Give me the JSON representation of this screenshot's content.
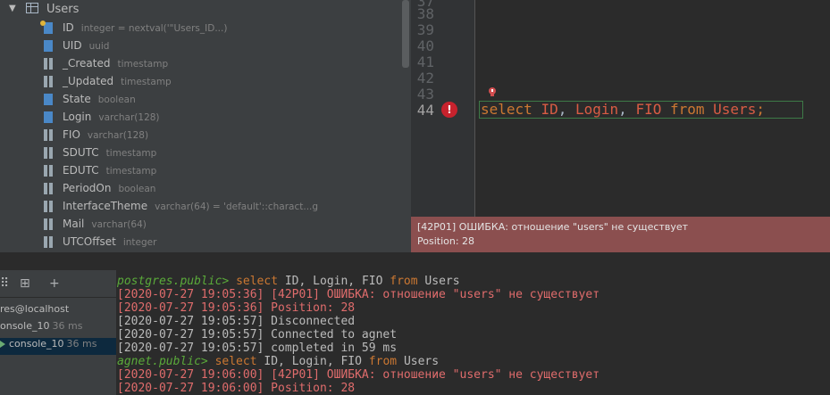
{
  "tree": {
    "table_name": "Users",
    "columns": [
      {
        "name": "ID",
        "type": "integer = nextval('\"Users_ID...)",
        "icon": "pk-column-icon"
      },
      {
        "name": "UID",
        "type": "uuid",
        "icon": "column-icon"
      },
      {
        "name": "_Created",
        "type": "timestamp",
        "icon": "column-icon"
      },
      {
        "name": "_Updated",
        "type": "timestamp",
        "icon": "column-icon"
      },
      {
        "name": "State",
        "type": "boolean",
        "icon": "column-icon"
      },
      {
        "name": "Login",
        "type": "varchar(128)",
        "icon": "column-icon"
      },
      {
        "name": "FIO",
        "type": "varchar(128)",
        "icon": "column-icon"
      },
      {
        "name": "SDUTC",
        "type": "timestamp",
        "icon": "column-icon"
      },
      {
        "name": "EDUTC",
        "type": "timestamp",
        "icon": "column-icon"
      },
      {
        "name": "PeriodOn",
        "type": "boolean",
        "icon": "column-icon"
      },
      {
        "name": "InterfaceTheme",
        "type": "varchar(64) = 'default'::charact...g",
        "icon": "column-icon"
      },
      {
        "name": "Mail",
        "type": "varchar(64)",
        "icon": "column-icon"
      },
      {
        "name": "UTCOffset",
        "type": "integer",
        "icon": "column-icon"
      }
    ]
  },
  "editor": {
    "line_numbers": [
      "37",
      "38",
      "39",
      "40",
      "41",
      "42",
      "43",
      "44"
    ],
    "code": {
      "k1": "select",
      "id1": "ID",
      "c1": ",",
      "id2": "Login",
      "c2": ",",
      "id3": "FIO",
      "k2": "from",
      "id4": "Users",
      "semi": ";"
    },
    "error_popup": {
      "line1": "[42P01] ОШИБКА: отношение \"users\" не существует",
      "line2": "Position: 28"
    }
  },
  "services": {
    "items": [
      {
        "label": "res@localhost",
        "ms": ""
      },
      {
        "label": "onsole_10",
        "ms": "36 ms"
      },
      {
        "label": "console_10",
        "ms": "36 ms"
      }
    ]
  },
  "console": {
    "lines": [
      {
        "prompt": "postgres.public>",
        "k1": "select",
        "t1": "ID,",
        "t2": "Login,",
        "t3": "FIO",
        "k2": "from",
        "t4": "Users"
      },
      {
        "err": "[2020-07-27 19:05:36] [42P01] ОШИБКА: отношение \"users\" не существует"
      },
      {
        "err": "[2020-07-27 19:05:36] Position: 28"
      },
      {
        "txt": "[2020-07-27 19:05:57] Disconnected"
      },
      {
        "txt": "[2020-07-27 19:05:57] Connected to agnet"
      },
      {
        "txt": "[2020-07-27 19:05:57] completed in 59 ms"
      },
      {
        "prompt": "agnet.public>",
        "k1": "select",
        "t1": "ID,",
        "t2": "Login,",
        "t3": "FIO",
        "k2": "from",
        "t4": "Users"
      },
      {
        "err": "[2020-07-27 19:06:00] [42P01] ОШИБКА: отношение \"users\" не существует"
      },
      {
        "err": "[2020-07-27 19:06:00] Position: 28"
      }
    ]
  },
  "colors": {
    "error_popup_bg": "#8b4f4f",
    "keyword": "#cc7832",
    "identifier_error": "#d85c44",
    "console_error": "#e06c6c",
    "prompt": "#5aaa3a"
  }
}
